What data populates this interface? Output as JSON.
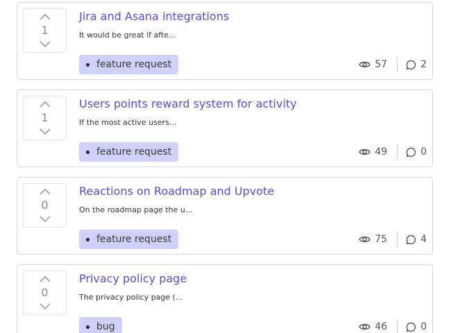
{
  "posts": [
    {
      "votes": "1",
      "title": "Jira and Asana integrations",
      "excerpt": "It would be great if afte...",
      "tag": "feature request",
      "views": "57",
      "comments": "2"
    },
    {
      "votes": "1",
      "title": "Users points reward system for activity",
      "excerpt": "If the most active users...",
      "tag": "feature request",
      "views": "49",
      "comments": "0"
    },
    {
      "votes": "0",
      "title": "Reactions on Roadmap and Upvote",
      "excerpt": "On the roadmap page the u...",
      "tag": "feature request",
      "views": "75",
      "comments": "4"
    },
    {
      "votes": "0",
      "title": "Privacy policy page",
      "excerpt": "The privacy policy page (...",
      "tag": "bug",
      "views": "46",
      "comments": "0"
    }
  ],
  "icons": {
    "upvote": "chevron-up-icon",
    "downvote": "chevron-down-icon",
    "views": "eye-icon",
    "comments": "comment-bubble-icon"
  },
  "colors": {
    "title": "#5b4bd1",
    "tag_background": "#cfd0fb",
    "border": "#d8d8dc"
  }
}
